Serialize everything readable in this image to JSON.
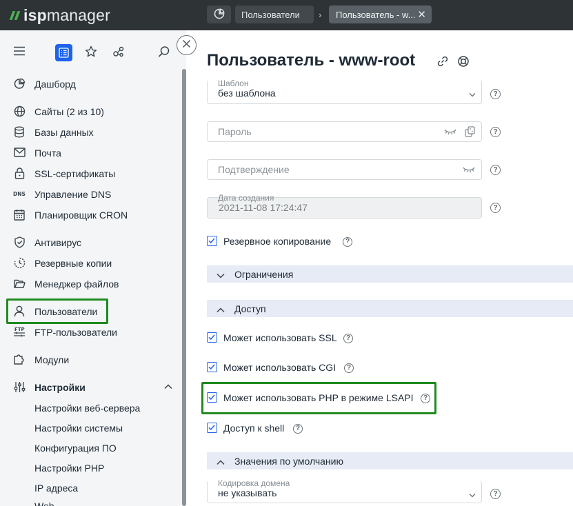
{
  "topbar": {
    "logo_isp": "isp",
    "logo_manager": "manager",
    "crumb_users": "Пользователи",
    "crumb_active": "Пользователь - w..."
  },
  "sidebar": {
    "items": [
      {
        "label": "Дашборд",
        "icon": "dashboard-icon"
      },
      {
        "label": "Сайты (2 из 10)",
        "icon": "globe-icon"
      },
      {
        "label": "Базы данных",
        "icon": "database-icon"
      },
      {
        "label": "Почта",
        "icon": "mail-icon"
      },
      {
        "label": "SSL-сертификаты",
        "icon": "lock-icon"
      },
      {
        "label": "Управление DNS",
        "icon": "dns-icon"
      },
      {
        "label": "Планировщик CRON",
        "icon": "calendar-icon"
      },
      {
        "label": "Антивирус",
        "icon": "shield-icon"
      },
      {
        "label": "Резервные копии",
        "icon": "backup-icon"
      },
      {
        "label": "Менеджер файлов",
        "icon": "folder-icon"
      },
      {
        "label": "Пользователи",
        "icon": "user-icon"
      },
      {
        "label": "FTP-пользователи",
        "icon": "ftp-icon"
      },
      {
        "label": "Модули",
        "icon": "modules-icon"
      },
      {
        "label": "Настройки",
        "icon": "settings-sliders-icon"
      }
    ],
    "settings_sub": [
      "Настройки веб-сервера",
      "Настройки системы",
      "Конфигурация ПО",
      "Настройки PHP",
      "IP адреса",
      "Web..."
    ]
  },
  "main": {
    "title": "Пользователь - www-root",
    "template": {
      "label": "Шаблон",
      "value": "без шаблона"
    },
    "password": {
      "placeholder": "Пароль"
    },
    "confirm": {
      "placeholder": "Подтверждение"
    },
    "created": {
      "label": "Дата создания",
      "value": "2021-11-08 17:24:47"
    },
    "backup_label": "Резервное копирование",
    "section_limits": "Ограничения",
    "section_access": "Доступ",
    "access": {
      "ssl": "Может использовать SSL",
      "cgi": "Может использовать CGI",
      "php": "Может использовать PHP в режиме LSAPI",
      "shell": "Доступ к shell"
    },
    "section_defaults": "Значения по умолчанию",
    "domain_encoding": {
      "label": "Кодировка домена",
      "value": "не указывать"
    },
    "help_glyph": "?"
  },
  "colors": {
    "topbar": "#2e3336",
    "accent": "#1d63ec",
    "highlight": "#1f8a1f",
    "section_bg": "#e6ebf5"
  }
}
